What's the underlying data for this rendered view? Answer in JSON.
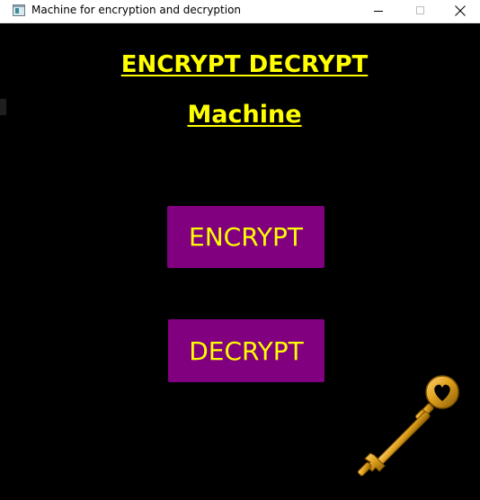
{
  "window": {
    "title": "Machine for encryption and decryption",
    "controls": [
      "minimize",
      "maximize",
      "close"
    ]
  },
  "main": {
    "heading_line1": "ENCRYPT DECRYPT",
    "heading_line2": "Machine",
    "encrypt_label": "ENCRYPT",
    "decrypt_label": "DECRYPT",
    "decoration": "key-icon"
  },
  "colors": {
    "background": "#000000",
    "heading_text": "#ffff00",
    "button_bg": "#800080",
    "button_text": "#ffff00",
    "key": "#e0a21c"
  }
}
